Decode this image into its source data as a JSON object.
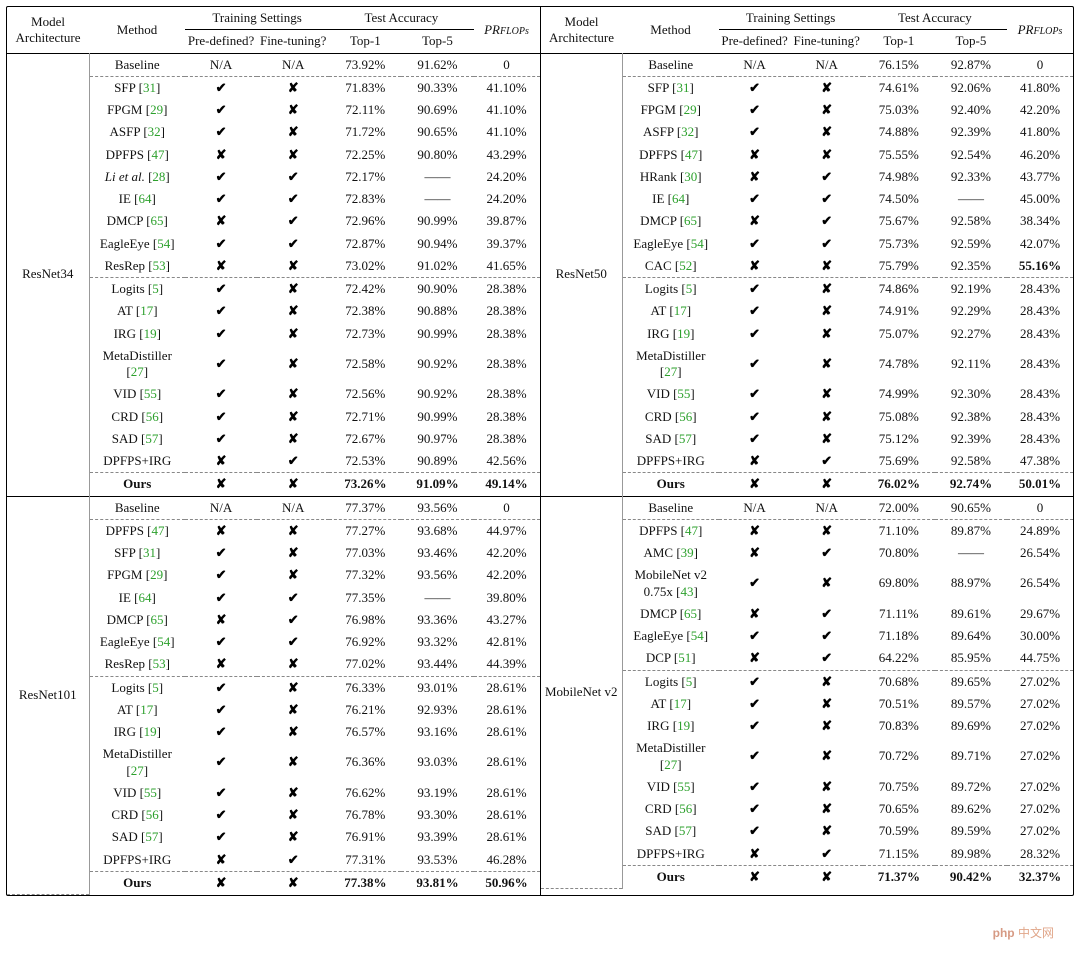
{
  "headers": {
    "arch": "Model\nArchitecture",
    "method": "Method",
    "train": "Training Settings",
    "pre": "Pre-defined?",
    "fine": "Fine-tuning?",
    "testacc": "Test Accuracy",
    "top1": "Top-1",
    "top5": "Top-5",
    "pr_label_html": "PR",
    "pr_sub": "FLOPs"
  },
  "marks": {
    "yes": "✔",
    "no": "✘",
    "na": "N/A",
    "dash": "——"
  },
  "watermark_a": "php",
  "watermark_b": "中文网",
  "panels": [
    {
      "side": "left",
      "blocks": [
        {
          "arch": "ResNet34",
          "groups": [
            [
              {
                "m": "Baseline",
                "ref": "",
                "pre": "na",
                "fine": "na",
                "t1": "73.92%",
                "t5": "91.62%",
                "pr": "0"
              }
            ],
            [
              {
                "m": "SFP",
                "ref": "31",
                "pre": "yes",
                "fine": "no",
                "t1": "71.83%",
                "t5": "90.33%",
                "pr": "41.10%"
              },
              {
                "m": "FPGM",
                "ref": "29",
                "pre": "yes",
                "fine": "no",
                "t1": "72.11%",
                "t5": "90.69%",
                "pr": "41.10%"
              },
              {
                "m": "ASFP",
                "ref": "32",
                "pre": "yes",
                "fine": "no",
                "t1": "71.72%",
                "t5": "90.65%",
                "pr": "41.10%"
              },
              {
                "m": "DPFPS",
                "ref": "47",
                "pre": "no",
                "fine": "no",
                "t1": "72.25%",
                "t5": "90.80%",
                "pr": "43.29%"
              },
              {
                "m": "Li et al.",
                "ref": "28",
                "italic": true,
                "pre": "yes",
                "fine": "yes",
                "t1": "72.17%",
                "t5": "——",
                "pr": "24.20%"
              },
              {
                "m": "IE",
                "ref": "64",
                "pre": "yes",
                "fine": "yes",
                "t1": "72.83%",
                "t5": "——",
                "pr": "24.20%"
              },
              {
                "m": "DMCP",
                "ref": "65",
                "pre": "no",
                "fine": "yes",
                "t1": "72.96%",
                "t5": "90.99%",
                "pr": "39.87%"
              },
              {
                "m": "EagleEye",
                "ref": "54",
                "pre": "yes",
                "fine": "yes",
                "t1": "72.87%",
                "t5": "90.94%",
                "pr": "39.37%"
              },
              {
                "m": "ResRep",
                "ref": "53",
                "pre": "no",
                "fine": "no",
                "t1": "73.02%",
                "t5": "91.02%",
                "pr": "41.65%"
              }
            ],
            [
              {
                "m": "Logits",
                "ref": "5",
                "pre": "yes",
                "fine": "no",
                "t1": "72.42%",
                "t5": "90.90%",
                "pr": "28.38%"
              },
              {
                "m": "AT",
                "ref": "17",
                "pre": "yes",
                "fine": "no",
                "t1": "72.38%",
                "t5": "90.88%",
                "pr": "28.38%"
              },
              {
                "m": "IRG",
                "ref": "19",
                "pre": "yes",
                "fine": "no",
                "t1": "72.73%",
                "t5": "90.99%",
                "pr": "28.38%"
              },
              {
                "m": "MetaDistiller",
                "ref": "27",
                "pre": "yes",
                "fine": "no",
                "t1": "72.58%",
                "t5": "90.92%",
                "pr": "28.38%"
              },
              {
                "m": "VID",
                "ref": "55",
                "pre": "yes",
                "fine": "no",
                "t1": "72.56%",
                "t5": "90.92%",
                "pr": "28.38%"
              },
              {
                "m": "CRD",
                "ref": "56",
                "pre": "yes",
                "fine": "no",
                "t1": "72.71%",
                "t5": "90.99%",
                "pr": "28.38%"
              },
              {
                "m": "SAD",
                "ref": "57",
                "pre": "yes",
                "fine": "no",
                "t1": "72.67%",
                "t5": "90.97%",
                "pr": "28.38%"
              },
              {
                "m": "DPFPS+IRG",
                "ref": "",
                "pre": "no",
                "fine": "yes",
                "t1": "72.53%",
                "t5": "90.89%",
                "pr": "42.56%"
              }
            ],
            [
              {
                "m": "Ours",
                "ref": "",
                "bold": true,
                "pre": "no",
                "fine": "no",
                "t1": "73.26%",
                "t5": "91.09%",
                "pr": "49.14%"
              }
            ]
          ]
        },
        {
          "arch": "ResNet101",
          "groups": [
            [
              {
                "m": "Baseline",
                "ref": "",
                "pre": "na",
                "fine": "na",
                "t1": "77.37%",
                "t5": "93.56%",
                "pr": "0"
              }
            ],
            [
              {
                "m": "DPFPS",
                "ref": "47",
                "pre": "no",
                "fine": "no",
                "t1": "77.27%",
                "t5": "93.68%",
                "pr": "44.97%"
              },
              {
                "m": "SFP",
                "ref": "31",
                "pre": "yes",
                "fine": "no",
                "t1": "77.03%",
                "t5": "93.46%",
                "pr": "42.20%"
              },
              {
                "m": "FPGM",
                "ref": "29",
                "pre": "yes",
                "fine": "no",
                "t1": "77.32%",
                "t5": "93.56%",
                "pr": "42.20%"
              },
              {
                "m": "IE",
                "ref": "64",
                "pre": "yes",
                "fine": "yes",
                "t1": "77.35%",
                "t5": "——",
                "pr": "39.80%"
              },
              {
                "m": "DMCP",
                "ref": "65",
                "pre": "no",
                "fine": "yes",
                "t1": "76.98%",
                "t5": "93.36%",
                "pr": "43.27%"
              },
              {
                "m": "EagleEye",
                "ref": "54",
                "pre": "yes",
                "fine": "yes",
                "t1": "76.92%",
                "t5": "93.32%",
                "pr": "42.81%"
              },
              {
                "m": "ResRep",
                "ref": "53",
                "pre": "no",
                "fine": "no",
                "t1": "77.02%",
                "t5": "93.44%",
                "pr": "44.39%"
              }
            ],
            [
              {
                "m": "Logits",
                "ref": "5",
                "pre": "yes",
                "fine": "no",
                "t1": "76.33%",
                "t5": "93.01%",
                "pr": "28.61%"
              },
              {
                "m": "AT",
                "ref": "17",
                "pre": "yes",
                "fine": "no",
                "t1": "76.21%",
                "t5": "92.93%",
                "pr": "28.61%"
              },
              {
                "m": "IRG",
                "ref": "19",
                "pre": "yes",
                "fine": "no",
                "t1": "76.57%",
                "t5": "93.16%",
                "pr": "28.61%"
              },
              {
                "m": "MetaDistiller",
                "ref": "27",
                "pre": "yes",
                "fine": "no",
                "t1": "76.36%",
                "t5": "93.03%",
                "pr": "28.61%"
              },
              {
                "m": "VID",
                "ref": "55",
                "pre": "yes",
                "fine": "no",
                "t1": "76.62%",
                "t5": "93.19%",
                "pr": "28.61%"
              },
              {
                "m": "CRD",
                "ref": "56",
                "pre": "yes",
                "fine": "no",
                "t1": "76.78%",
                "t5": "93.30%",
                "pr": "28.61%"
              },
              {
                "m": "SAD",
                "ref": "57",
                "pre": "yes",
                "fine": "no",
                "t1": "76.91%",
                "t5": "93.39%",
                "pr": "28.61%"
              },
              {
                "m": "DPFPS+IRG",
                "ref": "",
                "pre": "no",
                "fine": "yes",
                "t1": "77.31%",
                "t5": "93.53%",
                "pr": "46.28%"
              }
            ],
            [
              {
                "m": "Ours",
                "ref": "",
                "bold": true,
                "pre": "no",
                "fine": "no",
                "t1": "77.38%",
                "t5": "93.81%",
                "pr": "50.96%"
              }
            ]
          ]
        }
      ]
    },
    {
      "side": "right",
      "blocks": [
        {
          "arch": "ResNet50",
          "groups": [
            [
              {
                "m": "Baseline",
                "ref": "",
                "pre": "na",
                "fine": "na",
                "t1": "76.15%",
                "t5": "92.87%",
                "pr": "0"
              }
            ],
            [
              {
                "m": "SFP",
                "ref": "31",
                "pre": "yes",
                "fine": "no",
                "t1": "74.61%",
                "t5": "92.06%",
                "pr": "41.80%"
              },
              {
                "m": "FPGM",
                "ref": "29",
                "pre": "yes",
                "fine": "no",
                "t1": "75.03%",
                "t5": "92.40%",
                "pr": "42.20%"
              },
              {
                "m": "ASFP",
                "ref": "32",
                "pre": "yes",
                "fine": "no",
                "t1": "74.88%",
                "t5": "92.39%",
                "pr": "41.80%"
              },
              {
                "m": "DPFPS",
                "ref": "47",
                "pre": "no",
                "fine": "no",
                "t1": "75.55%",
                "t5": "92.54%",
                "pr": "46.20%"
              },
              {
                "m": "HRank",
                "ref": "30",
                "pre": "no",
                "fine": "yes",
                "t1": "74.98%",
                "t5": "92.33%",
                "pr": "43.77%"
              },
              {
                "m": "IE",
                "ref": "64",
                "pre": "yes",
                "fine": "yes",
                "t1": "74.50%",
                "t5": "——",
                "pr": "45.00%"
              },
              {
                "m": "DMCP",
                "ref": "65",
                "pre": "no",
                "fine": "yes",
                "t1": "75.67%",
                "t5": "92.58%",
                "pr": "38.34%"
              },
              {
                "m": "EagleEye",
                "ref": "54",
                "pre": "yes",
                "fine": "yes",
                "t1": "75.73%",
                "t5": "92.59%",
                "pr": "42.07%"
              },
              {
                "m": "CAC",
                "ref": "52",
                "pre": "no",
                "fine": "no",
                "t1": "75.79%",
                "t5": "92.35%",
                "pr": "55.16%",
                "pr_bold": true
              }
            ],
            [
              {
                "m": "Logits",
                "ref": "5",
                "pre": "yes",
                "fine": "no",
                "t1": "74.86%",
                "t5": "92.19%",
                "pr": "28.43%"
              },
              {
                "m": "AT",
                "ref": "17",
                "pre": "yes",
                "fine": "no",
                "t1": "74.91%",
                "t5": "92.29%",
                "pr": "28.43%"
              },
              {
                "m": "IRG",
                "ref": "19",
                "pre": "yes",
                "fine": "no",
                "t1": "75.07%",
                "t5": "92.27%",
                "pr": "28.43%"
              },
              {
                "m": "MetaDistiller",
                "ref": "27",
                "pre": "yes",
                "fine": "no",
                "t1": "74.78%",
                "t5": "92.11%",
                "pr": "28.43%"
              },
              {
                "m": "VID",
                "ref": "55",
                "pre": "yes",
                "fine": "no",
                "t1": "74.99%",
                "t5": "92.30%",
                "pr": "28.43%"
              },
              {
                "m": "CRD",
                "ref": "56",
                "pre": "yes",
                "fine": "no",
                "t1": "75.08%",
                "t5": "92.38%",
                "pr": "28.43%"
              },
              {
                "m": "SAD",
                "ref": "57",
                "pre": "yes",
                "fine": "no",
                "t1": "75.12%",
                "t5": "92.39%",
                "pr": "28.43%"
              },
              {
                "m": "DPFPS+IRG",
                "ref": "",
                "pre": "no",
                "fine": "yes",
                "t1": "75.69%",
                "t5": "92.58%",
                "pr": "47.38%"
              }
            ],
            [
              {
                "m": "Ours",
                "ref": "",
                "bold": true,
                "pre": "no",
                "fine": "no",
                "t1": "76.02%",
                "t5": "92.74%",
                "pr": "50.01%",
                "pr_bold": false
              }
            ]
          ]
        },
        {
          "arch": "MobileNet v2",
          "groups": [
            [
              {
                "m": "Baseline",
                "ref": "",
                "pre": "na",
                "fine": "na",
                "t1": "72.00%",
                "t5": "90.65%",
                "pr": "0"
              }
            ],
            [
              {
                "m": "DPFPS",
                "ref": "47",
                "pre": "no",
                "fine": "no",
                "t1": "71.10%",
                "t5": "89.87%",
                "pr": "24.89%"
              },
              {
                "m": "AMC",
                "ref": "39",
                "pre": "no",
                "fine": "yes",
                "t1": "70.80%",
                "t5": "——",
                "pr": "26.54%"
              },
              {
                "m": "MobileNet v2 0.75x",
                "ref": "43",
                "pre": "yes",
                "fine": "no",
                "t1": "69.80%",
                "t5": "88.97%",
                "pr": "26.54%"
              },
              {
                "m": "DMCP",
                "ref": "65",
                "pre": "no",
                "fine": "yes",
                "t1": "71.11%",
                "t5": "89.61%",
                "pr": "29.67%"
              },
              {
                "m": "EagleEye",
                "ref": "54",
                "pre": "yes",
                "fine": "yes",
                "t1": "71.18%",
                "t5": "89.64%",
                "pr": "30.00%"
              },
              {
                "m": "DCP",
                "ref": "51",
                "pre": "no",
                "fine": "yes",
                "t1": "64.22%",
                "t5": "85.95%",
                "pr": "44.75%"
              }
            ],
            [
              {
                "m": "Logits",
                "ref": "5",
                "pre": "yes",
                "fine": "no",
                "t1": "70.68%",
                "t5": "89.65%",
                "pr": "27.02%"
              },
              {
                "m": "AT",
                "ref": "17",
                "pre": "yes",
                "fine": "no",
                "t1": "70.51%",
                "t5": "89.57%",
                "pr": "27.02%"
              },
              {
                "m": "IRG",
                "ref": "19",
                "pre": "yes",
                "fine": "no",
                "t1": "70.83%",
                "t5": "89.69%",
                "pr": "27.02%"
              },
              {
                "m": "MetaDistiller",
                "ref": "27",
                "pre": "yes",
                "fine": "no",
                "t1": "70.72%",
                "t5": "89.71%",
                "pr": "27.02%"
              },
              {
                "m": "VID",
                "ref": "55",
                "pre": "yes",
                "fine": "no",
                "t1": "70.75%",
                "t5": "89.72%",
                "pr": "27.02%"
              },
              {
                "m": "CRD",
                "ref": "56",
                "pre": "yes",
                "fine": "no",
                "t1": "70.65%",
                "t5": "89.62%",
                "pr": "27.02%"
              },
              {
                "m": "SAD",
                "ref": "57",
                "pre": "yes",
                "fine": "no",
                "t1": "70.59%",
                "t5": "89.59%",
                "pr": "27.02%"
              },
              {
                "m": "DPFPS+IRG",
                "ref": "",
                "pre": "no",
                "fine": "yes",
                "t1": "71.15%",
                "t5": "89.98%",
                "pr": "28.32%"
              }
            ],
            [
              {
                "m": "Ours",
                "ref": "",
                "bold": true,
                "pre": "no",
                "fine": "no",
                "t1": "71.37%",
                "t5": "90.42%",
                "pr": "32.37%"
              }
            ]
          ]
        }
      ]
    }
  ]
}
